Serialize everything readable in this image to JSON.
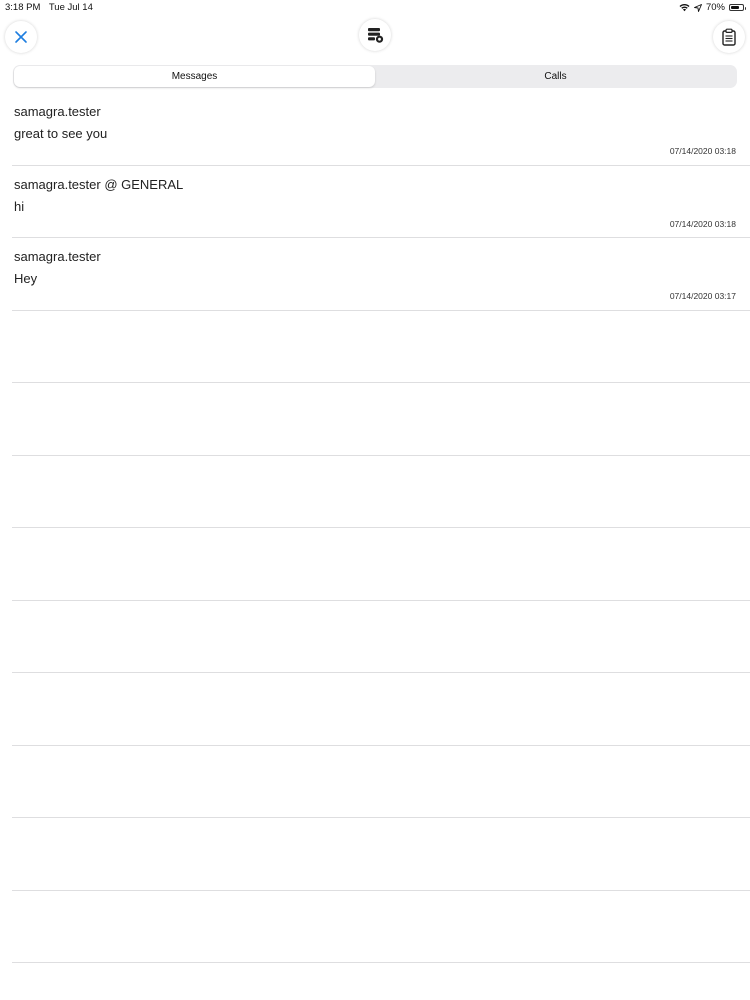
{
  "status_bar": {
    "time": "3:18 PM",
    "date": "Tue Jul 14",
    "battery_percent": "70%",
    "battery_level": 0.7,
    "icons": [
      "wifi-icon",
      "location-arrow-icon",
      "battery-icon"
    ]
  },
  "navbar": {
    "close_icon": "close-icon",
    "center_icon": "server-settings-icon",
    "right_icon": "clipboard-icon",
    "accent_color": "#1e7ee0"
  },
  "tabs": [
    {
      "label": "Messages",
      "active": true
    },
    {
      "label": "Calls",
      "active": false
    }
  ],
  "messages": [
    {
      "sender": "samagra.tester",
      "text": "great to see you",
      "timestamp": "07/14/2020 03:18"
    },
    {
      "sender": "samagra.tester @ GENERAL",
      "text": "hi",
      "timestamp": "07/14/2020 03:18"
    },
    {
      "sender": "samagra.tester",
      "text": "Hey",
      "timestamp": "07/14/2020 03:17"
    }
  ],
  "empty_row_count": 9
}
